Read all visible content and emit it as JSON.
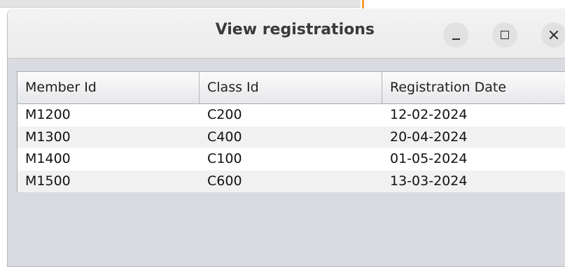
{
  "window": {
    "title": "View registrations"
  },
  "table": {
    "columns": [
      "Member Id",
      "Class Id",
      "Registration Date"
    ],
    "rows": [
      [
        "M1200",
        "C200",
        "12-02-2024"
      ],
      [
        "M1300",
        "C400",
        "20-04-2024"
      ],
      [
        "M1400",
        "C100",
        "01-05-2024"
      ],
      [
        "M1500",
        "C600",
        "13-03-2024"
      ]
    ]
  },
  "icons": {
    "minimize": "minimize-icon",
    "maximize": "maximize-icon",
    "close": "close-icon"
  },
  "colors": {
    "window_body": "#d9dbe0",
    "titlebar": "#efefef",
    "row_alt": "#f1f1f1",
    "button_bg": "#e1e1e1"
  }
}
